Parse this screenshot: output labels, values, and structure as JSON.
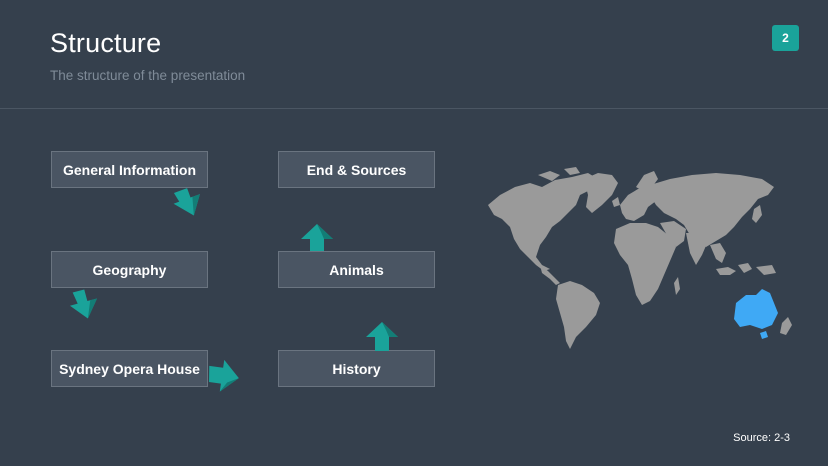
{
  "slide": {
    "title": "Structure",
    "subtitle": "The structure of the presentation",
    "page_number": "2",
    "source": "Source: 2-3"
  },
  "boxes": {
    "general_information": "General Information",
    "geography": "Geography",
    "sydney_opera_house": "Sydney Opera House",
    "end_sources": "End & Sources",
    "animals": "Animals",
    "history": "History"
  },
  "colors": {
    "background": "#35404d",
    "box": "#4a5563",
    "accent": "#1aa39a",
    "map_land": "#9a9a9a",
    "australia_highlight": "#3fa9f5"
  },
  "icons": [
    "arrow-down-right-icon",
    "arrow-down-icon",
    "arrow-right-icon",
    "arrow-up-icon",
    "world-map"
  ]
}
